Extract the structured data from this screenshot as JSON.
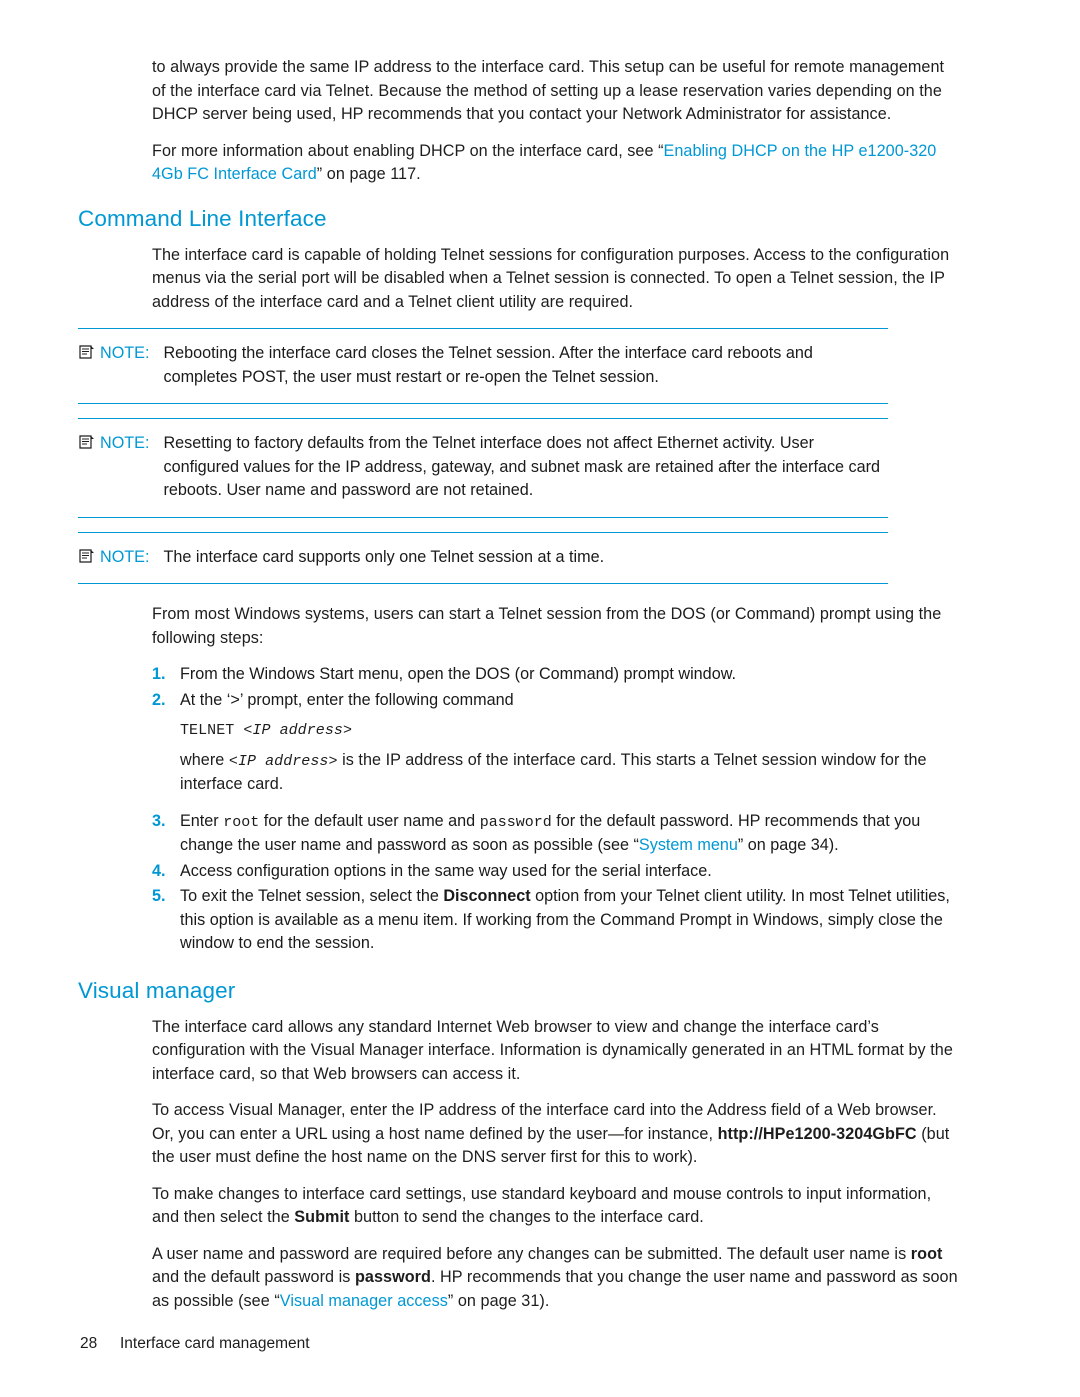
{
  "document": {
    "paragraphs": {
      "intro": "to always provide the same IP address to the interface card. This setup can be useful for remote management of the interface card via Telnet. Because the method of setting up a lease reservation varies depending on the DHCP server being used, HP recommends that you contact your Network Administrator for assistance.",
      "more_info_prefix": "For more information about enabling DHCP on the interface card, see “",
      "more_info_link": "Enabling DHCP on the HP e1200-320 4Gb FC Interface Card",
      "more_info_suffix": "” on page 117."
    },
    "sections": [
      {
        "heading": "Command Line Interface",
        "intro": "The interface card is capable of holding Telnet sessions for configuration purposes. Access to the configuration menus via the serial port will be disabled when a Telnet session is connected. To open a Telnet session, the IP address of the interface card and a Telnet client utility are required."
      },
      {
        "heading": "Visual manager"
      }
    ],
    "notes": [
      {
        "label": "NOTE:",
        "text": "Rebooting the interface card closes the Telnet session. After the interface card reboots and completes POST, the user must restart or re-open the Telnet session."
      },
      {
        "label": "NOTE:",
        "text": "Resetting to factory defaults from the Telnet interface does not affect Ethernet activity. User configured values for the IP address, gateway, and subnet mask are retained after the interface card reboots. User name and password are not retained."
      },
      {
        "label": "NOTE:",
        "text": "The interface card supports only one Telnet session at a time."
      }
    ],
    "telnet": {
      "lead": "From most Windows systems, users can start a Telnet session from the DOS (or Command) prompt using the following steps:",
      "steps": [
        {
          "num": "1.",
          "text": "From the Windows Start menu, open the DOS (or Command) prompt window."
        },
        {
          "num": "2.",
          "text": "At the ‘>’ prompt, enter the following command"
        },
        {
          "num": "3.",
          "text": ""
        },
        {
          "num": "4.",
          "text": "Access configuration options in the same way used for the serial interface."
        },
        {
          "num": "5.",
          "text": ""
        }
      ],
      "command": "TELNET ",
      "command_arg": "<IP address>",
      "where_prefix": "where ",
      "where_arg": "<IP address>",
      "where_suffix": " is the IP address of the interface card. This starts a Telnet session window for the interface card.",
      "step3_a": "Enter ",
      "step3_root": "root",
      "step3_b": " for the default user name and ",
      "step3_password": "password",
      "step3_c": " for the default password. HP recommends that you change the user name and password as soon as possible (see “",
      "step3_link": "System menu",
      "step3_d": "” on page 34).",
      "step5_a": "To exit the Telnet session, select the ",
      "step5_bold": "Disconnect",
      "step5_b": " option from your Telnet client utility. In most Telnet utilities, this option is available as a menu item. If working from the Command Prompt in Windows, simply close the window to end the session."
    },
    "visual_manager": {
      "p1": "The interface card allows any standard Internet Web browser to view and change the interface card’s configuration with the Visual Manager interface. Information is dynamically generated in an HTML format by the interface card, so that Web browsers can access it.",
      "p2_a": "To access Visual Manager, enter the IP address of the interface card into the Address field of a Web browser. Or, you can enter a URL using a host name defined by the user—for instance, ",
      "p2_bold": "http://HPe1200-3204GbFC",
      "p2_b": " (but the user must define the host name on the DNS server first for this to work).",
      "p3_a": "To make changes to interface card settings, use standard keyboard and mouse controls to input information, and then select the ",
      "p3_bold": "Submit",
      "p3_b": " button to send the changes to the interface card.",
      "p4_a": "A user name and password are required before any changes can be submitted. The default user name is ",
      "p4_bold1": "root",
      "p4_b": " and the default password is ",
      "p4_bold2": "password",
      "p4_c": ". HP recommends that you change the user name and password as soon as possible (see “",
      "p4_link": "Visual manager access",
      "p4_d": "” on page 31)."
    },
    "footer": {
      "page_number": "28",
      "chapter": "Interface card management"
    },
    "colors": {
      "link": "#0098d4",
      "heading": "#0098d4",
      "text": "#1d1d1b"
    }
  }
}
